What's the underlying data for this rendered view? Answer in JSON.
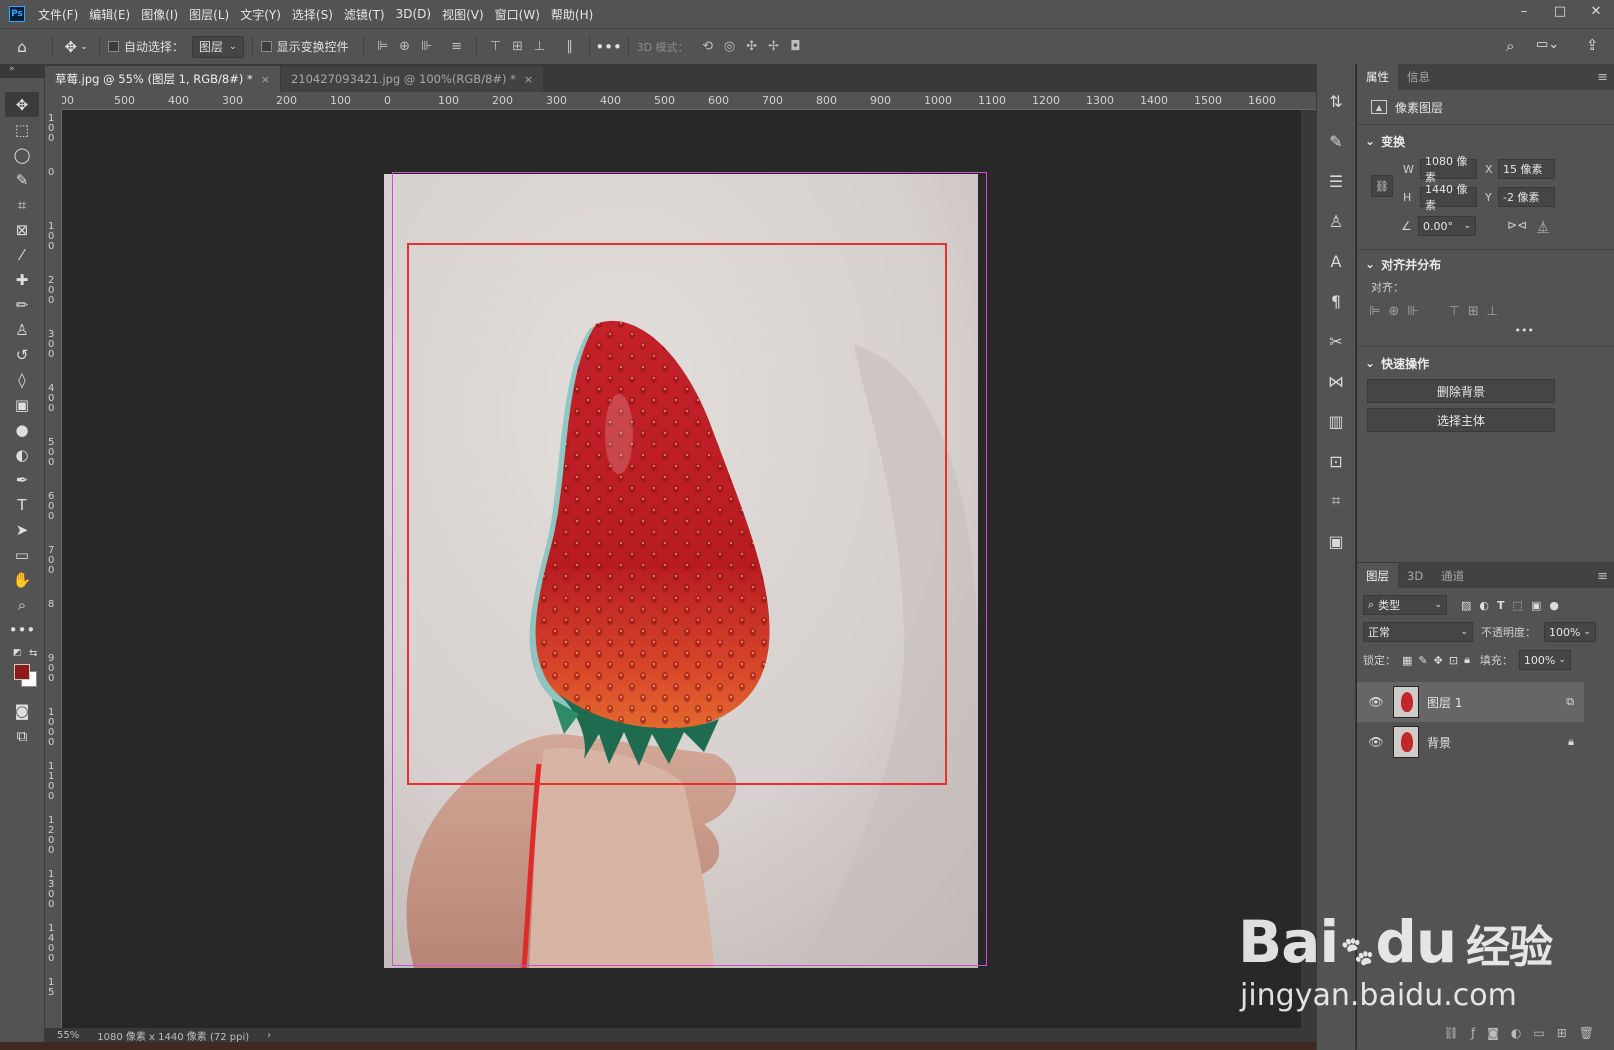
{
  "menubar": {
    "logo": "Ps",
    "items": [
      "文件(F)",
      "编辑(E)",
      "图像(I)",
      "图层(L)",
      "文字(Y)",
      "选择(S)",
      "滤镜(T)",
      "3D(D)",
      "视图(V)",
      "窗口(W)",
      "帮助(H)"
    ]
  },
  "options": {
    "auto_select_label": "自动选择：",
    "auto_select_target": "图层",
    "show_transform_label": "显示变换控件",
    "mode_3d_label": "3D 模式："
  },
  "left_strip": "»",
  "tabs": [
    {
      "label": "草莓.jpg @ 55% (图层 1, RGB/8#) *",
      "active": true
    },
    {
      "label": "210427093421.jpg @ 100%(RGB/8#) *",
      "active": false
    }
  ],
  "ruler_h": [
    "00",
    "500",
    "400",
    "300",
    "200",
    "100",
    "0",
    "100",
    "200",
    "300",
    "400",
    "500",
    "600",
    "700",
    "800",
    "900",
    "1000",
    "1100",
    "1200",
    "1300",
    "1400",
    "1500",
    "1600"
  ],
  "ruler_v": [
    "1\n0\n0",
    "0",
    "1\n0\n0",
    "2\n0\n0",
    "3\n0\n0",
    "4\n0\n0",
    "5\n0\n0",
    "6\n0\n0",
    "7\n0\n0",
    "8",
    "9\n0\n0",
    "1\n0\n0\n0",
    "1\n1\n0\n0",
    "1\n2\n0\n0",
    "1\n3\n0\n0",
    "1\n4\n0\n0",
    "1\n5"
  ],
  "status": {
    "zoom": "55%",
    "doc_info": "1080 像素 x 1440 像素 (72 ppi)",
    "arrow": "›"
  },
  "properties": {
    "tabs": [
      "属性",
      "信息"
    ],
    "layer_type": "像素图层",
    "transform_title": "变换",
    "w_label": "W",
    "w_value": "1080 像素",
    "x_label": "X",
    "x_value": "15 像素",
    "h_label": "H",
    "h_value": "1440 像素",
    "y_label": "Y",
    "y_value": "-2 像素",
    "angle_value": "0.00°",
    "align_title": "对齐并分布",
    "align_label": "对齐：",
    "more": "•••",
    "quick_title": "快速操作",
    "remove_bg": "删除背景",
    "select_subject": "选择主体"
  },
  "layers": {
    "tabs": [
      "图层",
      "3D",
      "通道"
    ],
    "filter_kind": "类型",
    "blend_mode": "正常",
    "opacity_label": "不透明度：",
    "opacity_value": "100%",
    "lock_label": "锁定：",
    "fill_label": "填充：",
    "fill_value": "100%",
    "items": [
      {
        "name": "图层 1",
        "selected": true
      },
      {
        "name": "背景",
        "selected": false
      }
    ]
  },
  "watermark": {
    "brand": "Bai",
    "brand2": "du",
    "cn": "经验",
    "url": "jingyan.baidu.com"
  },
  "colors": {
    "foreground": "#8e1a1a",
    "background": "#ffffff",
    "selection_box": "#e8312f",
    "layer_bounds": "#d14dd8"
  }
}
